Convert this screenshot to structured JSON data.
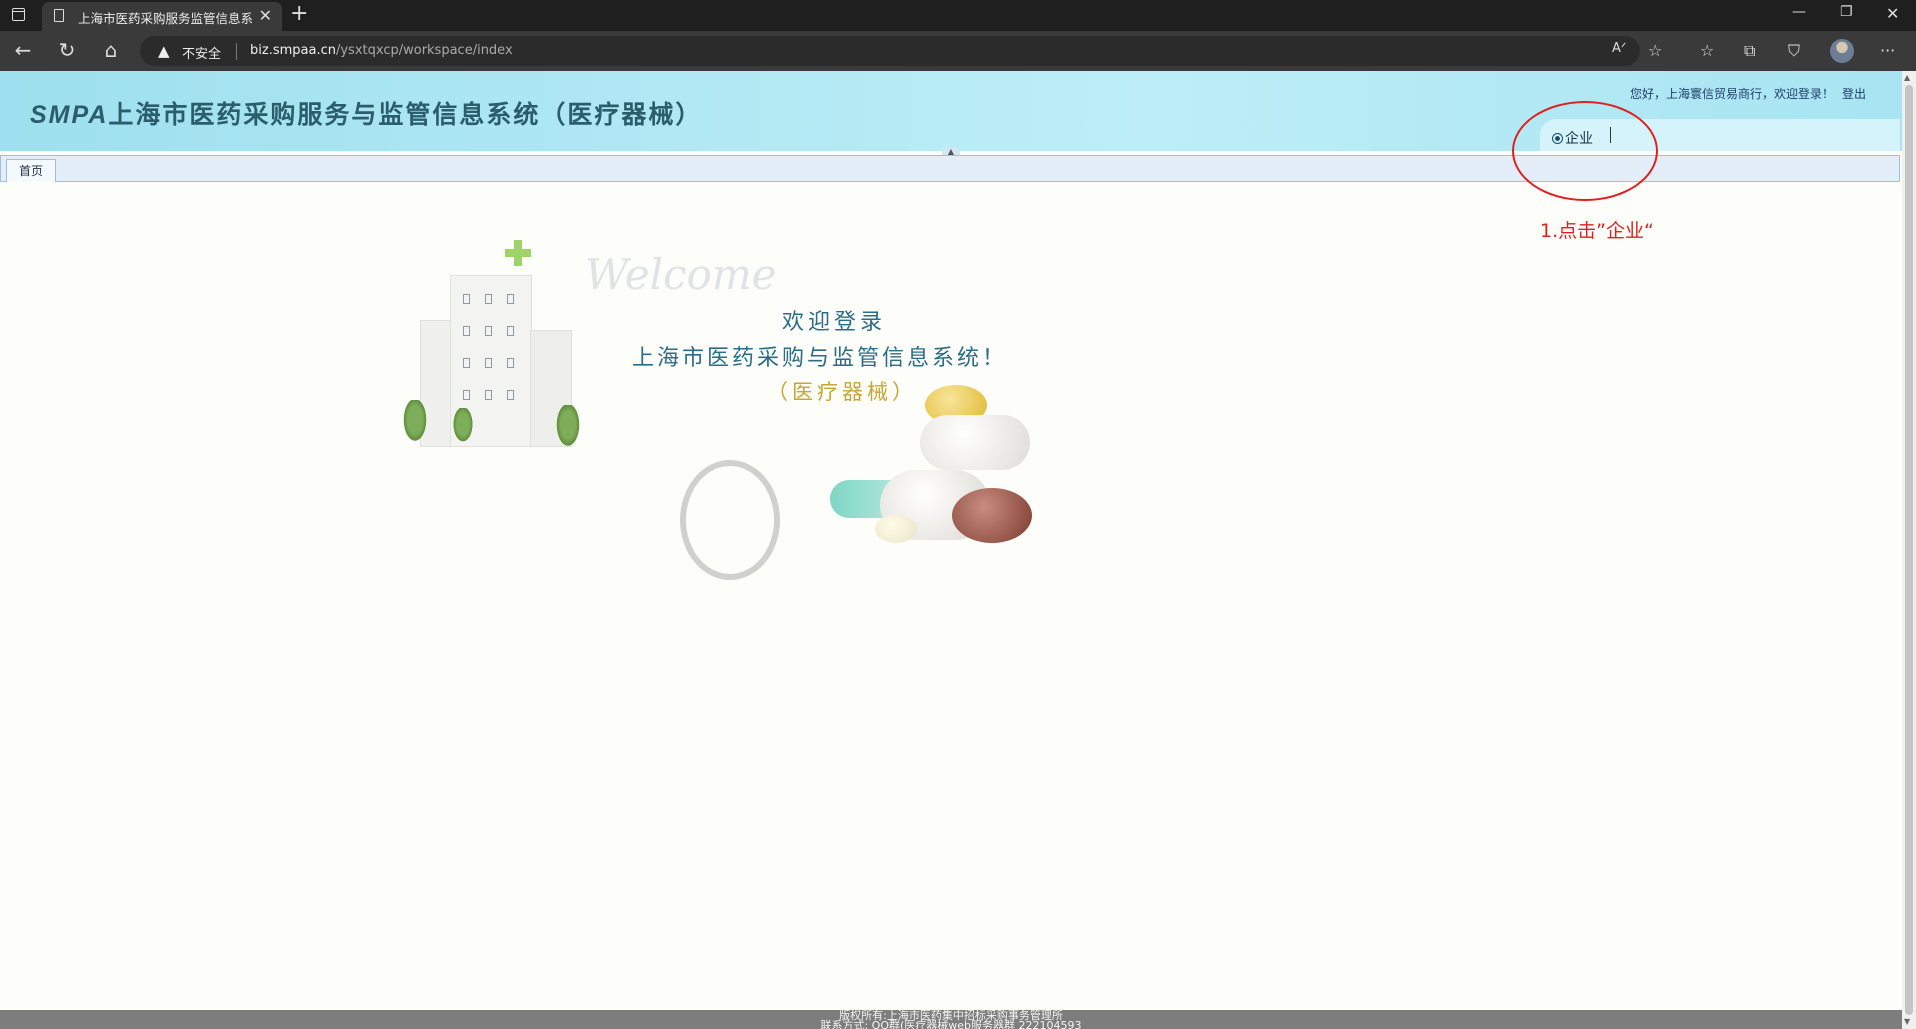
{
  "browser": {
    "tab_title": "上海市医药采购服务监管信息系",
    "url_warning": "不安全",
    "url_host": "biz.smpaa.cn",
    "url_path": "/ysxtqxcp/workspace/index"
  },
  "header": {
    "logo_prefix": "SMPA",
    "logo_title": "上海市医药采购服务与监管信息系统（医疗器械）",
    "greeting": "您好，上海寰信贸易商行，欢迎登录！",
    "logout": "登出",
    "nav_item": "企业"
  },
  "tabs": {
    "home": "首页"
  },
  "welcome": {
    "script": "Welcome",
    "line1": "欢迎登录",
    "line2": "上海市医药采购与监管信息系统！",
    "line3": "（医疗器械）"
  },
  "annotation": {
    "text": "1.点击”企业“",
    "color": "#e02020"
  },
  "footer": {
    "line1": "版权所有:上海市医药集中招标采购事务管理所",
    "line2": "联系方式: QQ群(医疗器械web服务器群 222104593"
  }
}
